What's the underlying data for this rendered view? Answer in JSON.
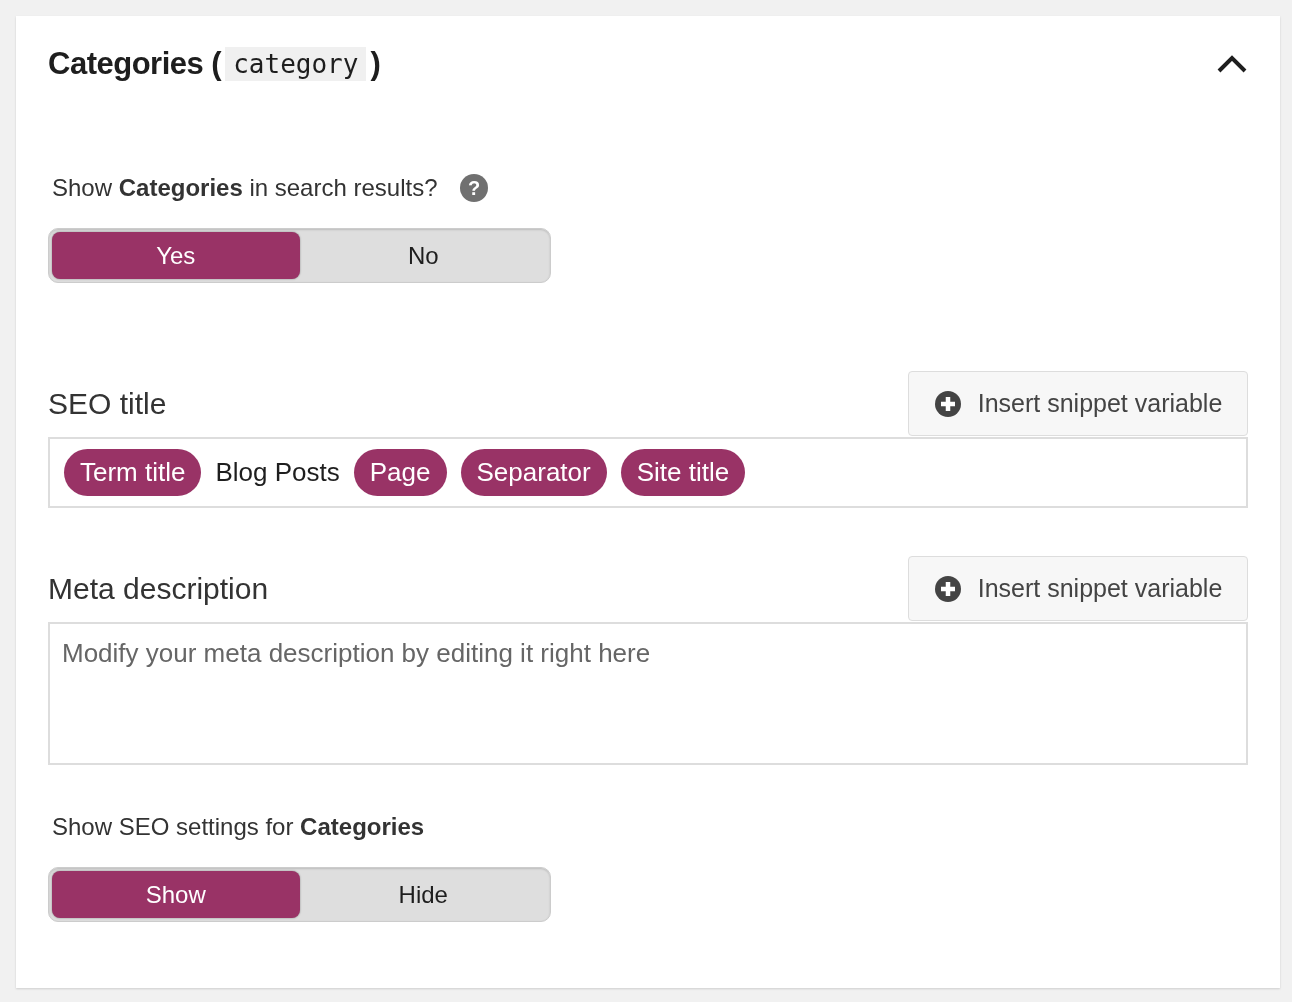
{
  "panel": {
    "title": "Categories (",
    "code": "category",
    "title_end": ")",
    "expanded": true
  },
  "visibility": {
    "question": "Show **Categories** in search results?",
    "help": "?",
    "options": [
      {
        "label": "Yes",
        "selected": true
      },
      {
        "label": "No",
        "selected": false
      }
    ]
  },
  "seo_title": {
    "label": "SEO title",
    "button": "Insert snippet variable",
    "tokens": [
      {
        "kind": "variable",
        "text": "Term title"
      },
      {
        "kind": "text",
        "text": "Blog Posts"
      },
      {
        "kind": "variable",
        "text": "Page"
      },
      {
        "kind": "variable",
        "text": "Separator"
      },
      {
        "kind": "variable",
        "text": "Site title"
      }
    ]
  },
  "meta_description": {
    "label": "Meta description",
    "button": "Insert snippet variable",
    "placeholder": "Modify your meta description by editing it right here"
  },
  "settings": {
    "question": "Show SEO settings for **Categories**",
    "options": [
      {
        "label": "Show",
        "selected": true
      },
      {
        "label": "Hide",
        "selected": false
      }
    ]
  }
}
